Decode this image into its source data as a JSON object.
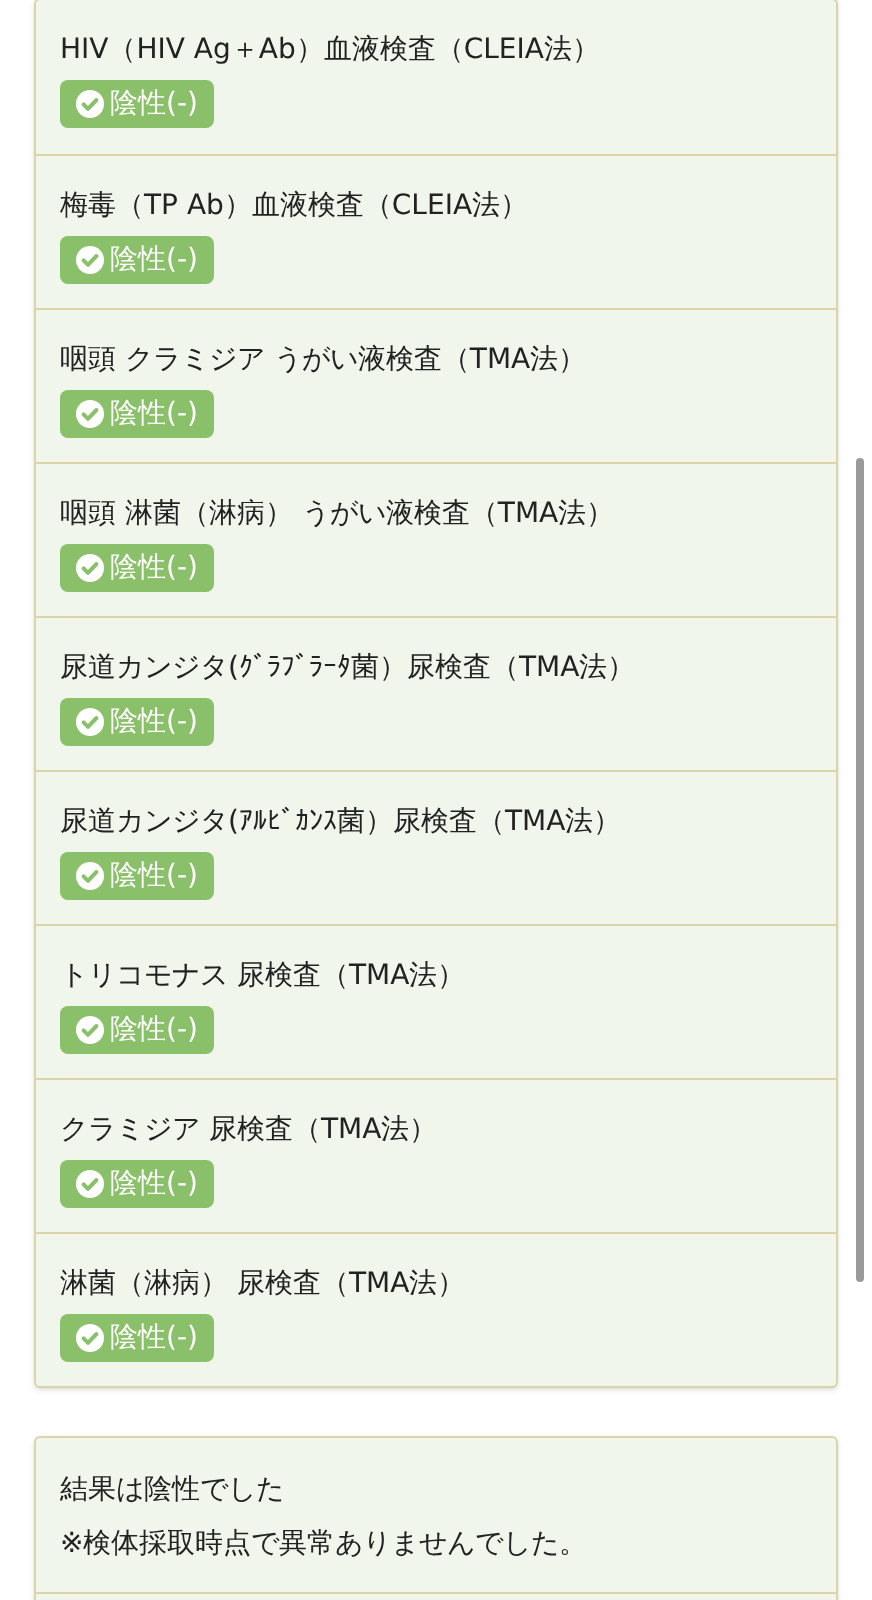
{
  "tests": [
    {
      "name": "HIV（HIV Ag＋Ab）血液検査（CLEIA法）",
      "result": {
        "kind": "negative",
        "label": "陰性(-)"
      }
    },
    {
      "name": "梅毒（TP Ab）血液検査（CLEIA法）",
      "result": {
        "kind": "negative",
        "label": "陰性(-)"
      }
    },
    {
      "name": "咽頭 クラミジア うがい液検査（TMA法）",
      "result": {
        "kind": "negative",
        "label": "陰性(-)"
      }
    },
    {
      "name": "咽頭 淋菌（淋病） うがい液検査（TMA法）",
      "result": {
        "kind": "negative",
        "label": "陰性(-)"
      }
    },
    {
      "name": "尿道カンジタ(ｸﾞﾗﾌﾞﾗｰﾀ菌）尿検査（TMA法）",
      "result": {
        "kind": "negative",
        "label": "陰性(-)"
      }
    },
    {
      "name": "尿道カンジタ(ｱﾙﾋﾞｶﾝｽ菌）尿検査（TMA法）",
      "result": {
        "kind": "negative",
        "label": "陰性(-)"
      }
    },
    {
      "name": "トリコモナス 尿検査（TMA法）",
      "result": {
        "kind": "negative",
        "label": "陰性(-)"
      }
    },
    {
      "name": "クラミジア 尿検査（TMA法）",
      "result": {
        "kind": "negative",
        "label": "陰性(-)"
      }
    },
    {
      "name": "淋菌（淋病） 尿検査（TMA法）",
      "result": {
        "kind": "negative",
        "label": "陰性(-)"
      }
    }
  ],
  "summary": {
    "lines": [
      "結果は陰性でした",
      "※検体採取時点で異常ありませんでした。"
    ]
  }
}
